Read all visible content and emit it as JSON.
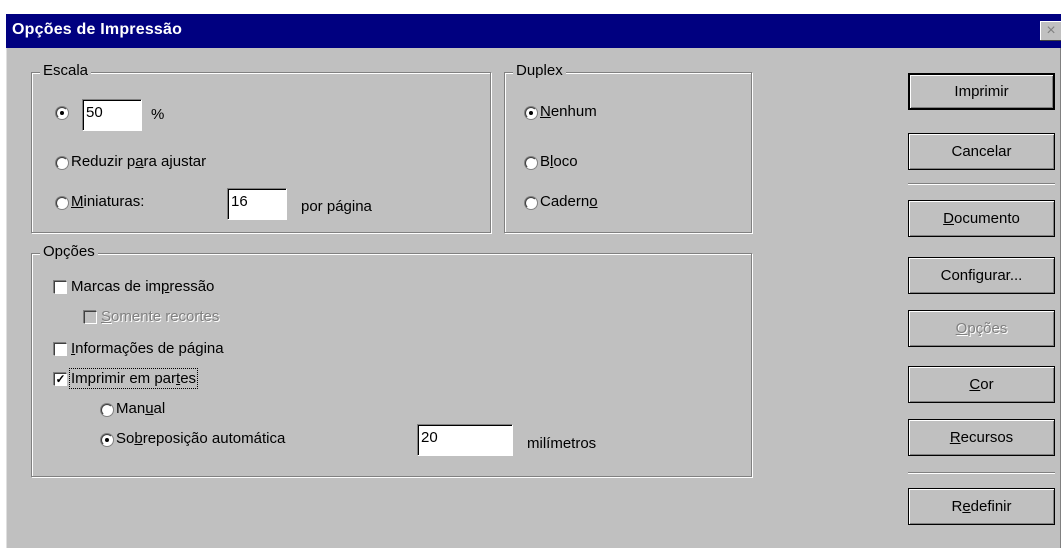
{
  "window": {
    "title": "Opções de Impressão",
    "close_glyph": "×"
  },
  "escala": {
    "legend": "Escala",
    "scale_value": "50",
    "percent": "%",
    "reduce_label_pre": "Reduzir p",
    "reduce_label_u": "a",
    "reduce_label_post": "ra ajustar",
    "thumbs_label_u": "M",
    "thumbs_label_post": "iniaturas:",
    "thumbs_value": "16",
    "per_page": "por página",
    "selected": "percent"
  },
  "duplex": {
    "legend": "Duplex",
    "none_u": "N",
    "none_post": "enhum",
    "block_pre": "B",
    "block_u": "l",
    "block_post": "oco",
    "book_pre": "Cadern",
    "book_u": "o",
    "selected": "none"
  },
  "opcoes": {
    "legend": "Opções",
    "marks_pre": "Marcas de im",
    "marks_u": "p",
    "marks_post": "ressão",
    "marks_checked": false,
    "crops_u": "S",
    "crops_post": "omente recortes",
    "crops_checked": false,
    "crops_enabled": false,
    "pageinfo_u": "I",
    "pageinfo_post": "nformações de página",
    "pageinfo_checked": false,
    "tile_pre": "Imprimir em par",
    "tile_u": "t",
    "tile_post": "es",
    "tile_checked": true,
    "manual_pre": "Man",
    "manual_u": "u",
    "manual_post": "al",
    "auto_pre": "So",
    "auto_u": "b",
    "auto_post": "reposição automática",
    "tile_mode": "auto",
    "overlap_value": "20",
    "overlap_unit": "milímetros",
    "check_glyph": "✓"
  },
  "buttons": {
    "print": "Imprimir",
    "cancel": "Cancelar",
    "document_u": "D",
    "document_post": "ocumento",
    "setup_pre": "Confi",
    "setup_u": "g",
    "setup_post": "urar...",
    "options_u": "O",
    "options_post": "pções",
    "color_u": "C",
    "color_post": "or",
    "resources_u": "R",
    "resources_post": "ecursos",
    "reset_pre": "R",
    "reset_u": "e",
    "reset_post": "definir"
  },
  "colors": {
    "titlebar": "#000080",
    "face": "#c0c0c0"
  }
}
